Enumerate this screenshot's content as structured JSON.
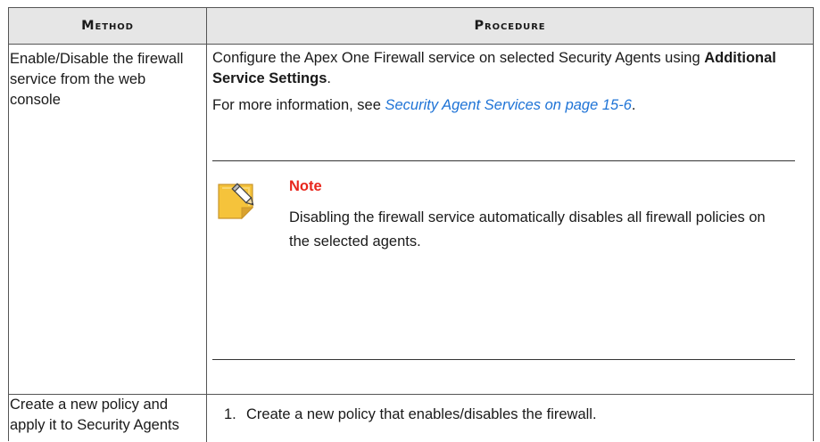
{
  "header": {
    "method": "Method",
    "procedure": "Procedure"
  },
  "rows": [
    {
      "method": "Enable/Disable the firewall service from the web console",
      "procedure": {
        "p1_before": "Configure the Apex One Firewall service on selected Security Agents using ",
        "p1_bold": "Additional Service Settings",
        "p1_after": ".",
        "p2_before": "For more information, see ",
        "p2_link": "Security Agent Services on page 15-6",
        "p2_after": ".",
        "note_title": "Note",
        "note_body": "Disabling the firewall service automatically disables all firewall policies on the selected agents."
      }
    },
    {
      "method": "Create a new policy and apply it to Security Agents",
      "procedure": {
        "step1_num": "1.",
        "step1_text": "Create a new policy that enables/disables the firewall."
      }
    }
  ],
  "colors": {
    "link": "#1e73d6",
    "note_title": "#e8261c",
    "header_bg": "#e6e6e6",
    "note_icon": "#f5c33b"
  },
  "icons": {
    "note": "note-pencil-icon"
  }
}
